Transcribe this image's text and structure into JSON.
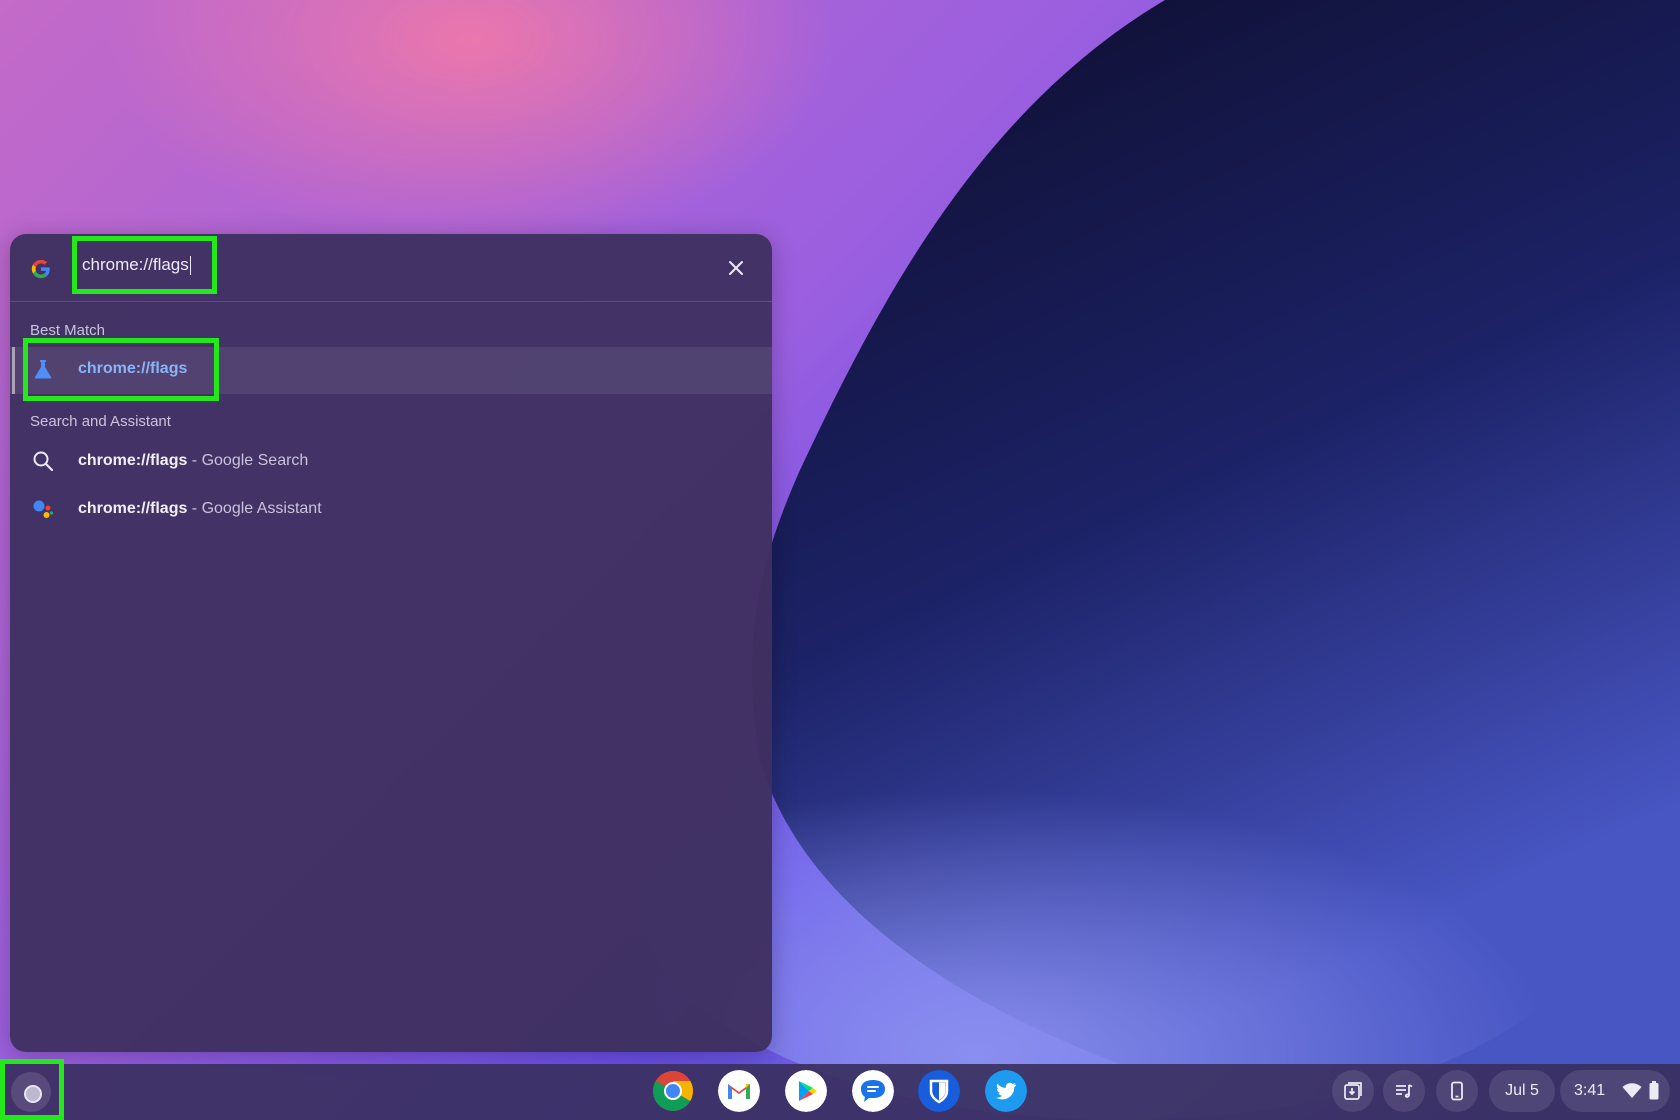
{
  "launcher": {
    "search_value": "chrome://flags",
    "close_label": "×",
    "best_match_title": "Best Match",
    "best_match_item": "chrome://flags",
    "search_assistant_title": "Search and Assistant",
    "results": [
      {
        "query": "chrome://flags",
        "suffix": " - Google Search",
        "icon": "search-icon"
      },
      {
        "query": "chrome://flags",
        "suffix": " - Google Assistant",
        "icon": "google-assistant-icon"
      }
    ]
  },
  "shelf": {
    "apps": [
      "chrome-icon",
      "gmail-icon",
      "play-store-icon",
      "messages-icon",
      "bitwarden-icon",
      "twitter-icon"
    ],
    "date": "Jul 5",
    "time": "3:41"
  },
  "colors": {
    "highlight": "#25e81c",
    "link_blue": "#8ab4f8",
    "panel": "#3e3060"
  }
}
